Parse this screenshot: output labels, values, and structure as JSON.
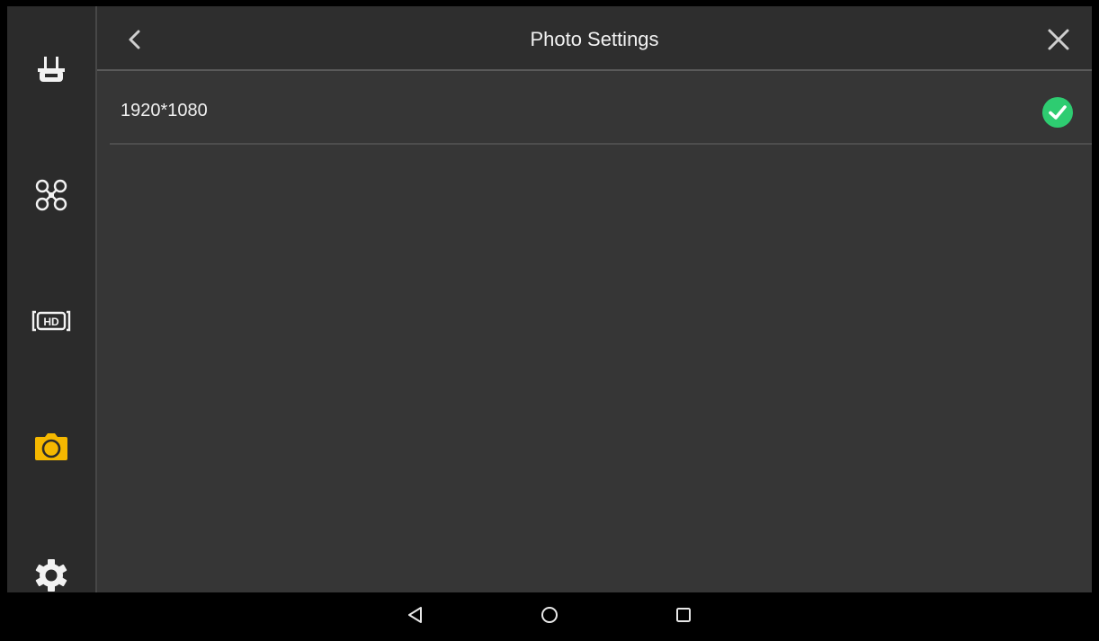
{
  "header": {
    "title": "Photo Settings",
    "back_icon": "chevron-left-icon",
    "close_icon": "close-icon"
  },
  "sidebar": {
    "items": [
      {
        "id": "remote-controller",
        "icon": "remote-controller-icon",
        "active": false
      },
      {
        "id": "aircraft",
        "icon": "drone-icon",
        "active": false
      },
      {
        "id": "hd-transmission",
        "icon": "hd-icon",
        "active": false
      },
      {
        "id": "camera",
        "icon": "camera-icon",
        "active": true
      },
      {
        "id": "general-settings",
        "icon": "gear-icon",
        "active": false
      }
    ]
  },
  "options": [
    {
      "label": "1920*1080",
      "selected": true
    }
  ],
  "system_nav": {
    "buttons": [
      "back-icon",
      "home-icon",
      "recents-icon"
    ]
  },
  "colors": {
    "accent_active": "#f5b800",
    "check_green": "#2ecc71",
    "icon_default": "#f2f2f2"
  }
}
